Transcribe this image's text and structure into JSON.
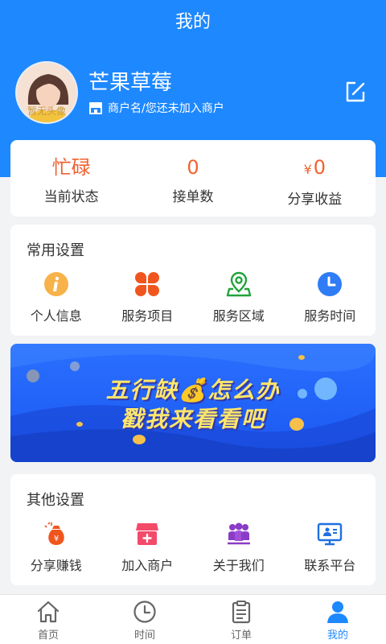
{
  "header": {
    "title": "我的"
  },
  "profile": {
    "avatar_text": "暂无头像",
    "name": "芒果草莓",
    "merchant_text": "商户名/您还未加入商户"
  },
  "stats": [
    {
      "value": "忙碌",
      "label": "当前状态"
    },
    {
      "value": "0",
      "label": "接单数"
    },
    {
      "currency": "¥",
      "value": "0",
      "label": "分享收益"
    }
  ],
  "common_settings": {
    "title": "常用设置",
    "items": [
      {
        "label": "个人信息",
        "icon": "info-icon"
      },
      {
        "label": "服务项目",
        "icon": "service-items-icon"
      },
      {
        "label": "服务区域",
        "icon": "location-pin-icon"
      },
      {
        "label": "服务时间",
        "icon": "clock-icon"
      }
    ]
  },
  "banner": {
    "line1": "五行缺💰怎么办",
    "line2": "戳我来看看吧"
  },
  "other_settings": {
    "title": "其他设置",
    "items": [
      {
        "label": "分享赚钱",
        "icon": "money-bag-icon"
      },
      {
        "label": "加入商户",
        "icon": "shop-icon"
      },
      {
        "label": "关于我们",
        "icon": "group-icon"
      },
      {
        "label": "联系平台",
        "icon": "monitor-contact-icon"
      }
    ]
  },
  "tabbar": [
    {
      "label": "首页",
      "icon": "home-icon"
    },
    {
      "label": "时间",
      "icon": "clock-icon"
    },
    {
      "label": "订单",
      "icon": "order-icon"
    },
    {
      "label": "我的",
      "icon": "user-icon",
      "active": true
    }
  ],
  "colors": {
    "primary": "#1e88ff",
    "accent": "#f06232",
    "banner_text": "#ffe66b"
  }
}
